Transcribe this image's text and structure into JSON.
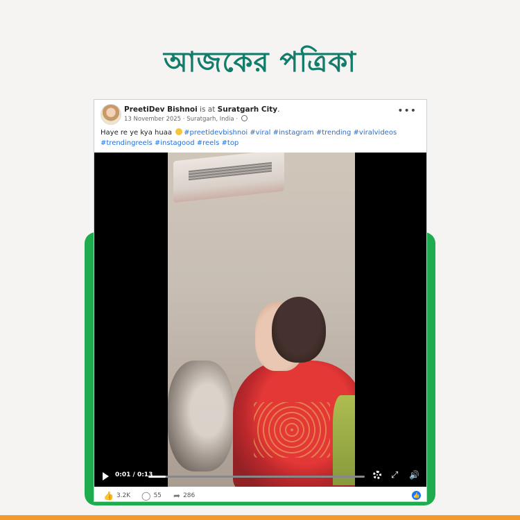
{
  "brand": {
    "title": "আজকের পত্রিকা"
  },
  "colors": {
    "brand_green": "#137c6a",
    "frame_green": "#1fac4f",
    "accent_orange": "#f39a2e",
    "link_blue": "#216fdb"
  },
  "post": {
    "author": "PreetiDev Bishnoi",
    "is_at": "is at",
    "place": "Suratgarh City",
    "place_suffix": ".",
    "date": "13 November 2025",
    "location": "Suratgarh, India",
    "separator": "·",
    "caption_text": "Haye re ye kya huaa",
    "hashtags": [
      "#preetidevbishnoi",
      "#viral",
      "#instagram",
      "#trending",
      "#viralvideos",
      "#trendingreels",
      "#instagood",
      "#reels",
      "#top"
    ]
  },
  "video": {
    "time_display": "0:01 / 0:13",
    "progress_fraction": 0.08,
    "icons": {
      "play": "play-icon",
      "settings": "gear-icon",
      "fullscreen": "fullscreen-icon",
      "volume": "volume-icon"
    }
  },
  "stats": {
    "likes": "3.2K",
    "comments": "55",
    "shares": "286"
  }
}
